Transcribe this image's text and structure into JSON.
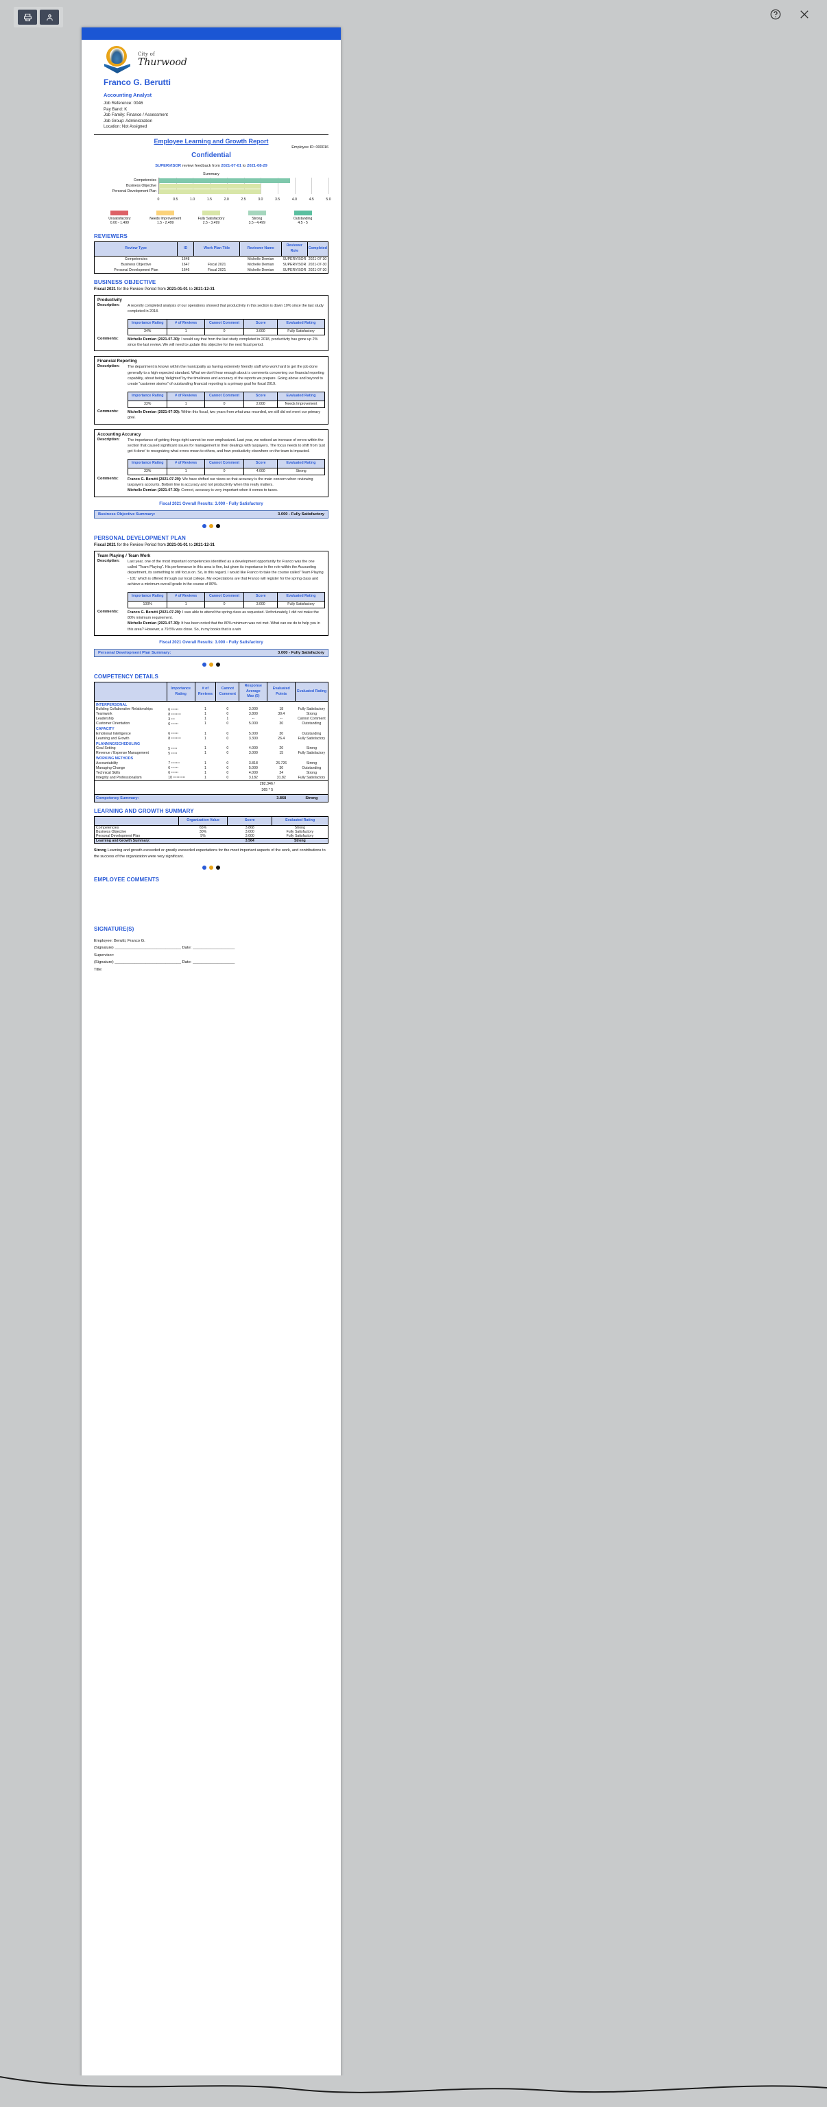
{
  "viewer": {
    "tools": [
      {
        "name": "print-tool",
        "icon": "printer-icon"
      },
      {
        "name": "person-tool",
        "icon": "person-icon"
      }
    ],
    "right_icons": [
      {
        "name": "help-button",
        "icon": "help-circle-icon"
      },
      {
        "name": "close-button",
        "icon": "close-icon"
      }
    ]
  },
  "logo": {
    "city_word": "City of",
    "name_word": "Thurwood"
  },
  "employee": {
    "name": "Franco G. Berutti",
    "title": "Accounting Analyst",
    "job_reference": "Job Reference: 0046",
    "pay_band": "Pay Band: K",
    "job_family": "Job Family: Finance / Assessment",
    "job_group": "Job Group: Administration",
    "location": "Location: Not Assigned",
    "employee_id": "Employee ID: 000016"
  },
  "report": {
    "title": "Employee Learning and Growth Report",
    "confidential": "Confidential",
    "feedback_role": "SUPERVISOR",
    "feedback_mid": " review feedback from ",
    "feedback_from": "2021-07-01",
    "feedback_to_sep": " to ",
    "feedback_to": "2021-08-29"
  },
  "chart_data": {
    "type": "bar",
    "title": "Summary",
    "orientation": "horizontal",
    "categories": [
      "Competencies",
      "Business Objective",
      "Personal Development Plan"
    ],
    "values": [
      3.868,
      3.0,
      3.0
    ],
    "colors": [
      "#7fc8ac",
      "#d8e6a8",
      "#d8e6a8"
    ],
    "xlabel": "",
    "ylabel": "",
    "xlim": [
      0,
      5
    ],
    "ticks": [
      "0",
      "0.5",
      "1.0",
      "1.5",
      "2.0",
      "2.5",
      "3.0",
      "3.5",
      "4.0",
      "4.5",
      "5.0"
    ],
    "grid": true,
    "legend_position": "below"
  },
  "legend": [
    {
      "label": "Unsatisfactory",
      "range": "0.00 - 1.499",
      "color": "#dd6166"
    },
    {
      "label": "Needs Improvement",
      "range": "1.5 - 2.499",
      "color": "#fbd27b"
    },
    {
      "label": "Fully Satisfactory",
      "range": "2.5 - 3.499",
      "color": "#d8e6a8"
    },
    {
      "label": "Strong",
      "range": "3.5 - 4.499",
      "color": "#a5d6bd"
    },
    {
      "label": "Outstanding",
      "range": "4.5 - 5",
      "color": "#5bbfa0"
    }
  ],
  "reviewers": {
    "heading": "REVIEWERS",
    "columns": [
      "Review Type",
      "ID",
      "Work Plan Title",
      "Reviewer Name",
      "Reviewer Role",
      "Completed"
    ],
    "rows": [
      [
        "Competencies",
        "1648",
        "",
        "Michelle Demian",
        "SUPERVISOR",
        "2021-07-30"
      ],
      [
        "Business Objective",
        "1647",
        "Fiscal 2021",
        "Michelle Demian",
        "SUPERVISOR",
        "2021-07-30"
      ],
      [
        "Personal Development Plan",
        "1646",
        "Fiscal 2021",
        "Michelle Demian",
        "SUPERVISOR",
        "2021-07-30"
      ]
    ]
  },
  "business_objective": {
    "heading": "BUSINESS OBJECTIVE",
    "fiscal_bold": "Fiscal 2021",
    "fiscal_mid": " for the Review Period from ",
    "period_from": "2021-01-01",
    "period_sep": " to ",
    "period_to": "2021-12-31",
    "score_columns": [
      "Importance Rating",
      "# of Reviews",
      "Cannot Comment",
      "Score",
      "Evaluated Rating"
    ],
    "label_description": "Description:",
    "label_comments": "Comments:",
    "items": [
      {
        "name": "Productivity",
        "description": "A recently completed analysis of our operations showed that productivity in this section is down 10% since the last study completed in 2018.",
        "scores": [
          "34%",
          "1",
          "0",
          "3.000",
          "Fully Satisfactory"
        ],
        "comments": [
          {
            "author": "Michelle Demian (2021-07-30):",
            "text": " I would say that from the last study completed in 2018, productivity has gone up 2% since the last review. We will need to update this objective for the next fiscal period."
          }
        ]
      },
      {
        "name": "Financial Reporting",
        "description": "The department is known within the municipality as having extremely friendly staff who work hard to get the job done generally to a high expected standard. What we don't hear enough about is comments concerning our financial reporting capability, about being 'delighted' by the timeliness and accuracy of the reports we prepare. Going above and beyond to create “customer stories” of outstanding financial reporting is a primary goal for fiscal 2019.",
        "scores": [
          "33%",
          "1",
          "0",
          "2.000",
          "Needs Improvement"
        ],
        "comments": [
          {
            "author": "Michelle Demian (2021-07-30):",
            "text": " Within this fiscal, two years from what was recorded, we still did not meet our primary goal."
          }
        ]
      },
      {
        "name": "Accounting Accuracy",
        "description": "The importance of getting things right cannot be over emphasized. Last year, we noticed an increase of errors within the section that caused significant issues for management in their dealings with taxpayers. The focus needs to shift from 'just get it done' to recognizing what errors mean to others, and how productivity elsewhere on the team is impacted.",
        "scores": [
          "33%",
          "1",
          "0",
          "4.000",
          "Strong"
        ],
        "comments": [
          {
            "author": "Franco G. Berutti (2021-07-29):",
            "text": " We have shifted our views so that accuracy is the main concern when reviewing taxpayers accounts. Bottom line is accuracy and not productivity when this really matters."
          },
          {
            "author": "Michelle Demian (2021-07-30):",
            "text": " Correct, accuracy is very important when it comes to taxes."
          }
        ]
      }
    ],
    "overall": "Fiscal 2021 Overall Results: 3.000 - Fully Satisfactory",
    "summary_label": "Business Objective Summary:",
    "summary_value": "3.000 - Fully Satisfactory"
  },
  "personal_development_plan": {
    "heading": "PERSONAL DEVELOPMENT PLAN",
    "fiscal_bold": "Fiscal 2021",
    "fiscal_mid": " for the Review Period from ",
    "period_from": "2021-01-01",
    "period_sep": " to ",
    "period_to": "2021-12-31",
    "items": [
      {
        "name": "Team Playing / Team Work",
        "description": "Last year, one of the most important competencies identified as a development opportunity for Franco was the one called \"Team Playing\". His performance in this area is fine, but given its importance in the role within the Accounting department, its something to still focus on. So, in this regard, I would like Franco to take the course called 'Team Playing - 101' which is offered through our local college. My expectations are that Franco will register for the spring class and achieve a minimum overall grade in the course of 80%.",
        "scores": [
          "100%",
          "1",
          "0",
          "3.000",
          "Fully Satisfactory"
        ],
        "comments": [
          {
            "author": "Franco G. Berutti (2021-07-29):",
            "text": " I was able to attend the spring class as requested. Unfortunately, I did not make the 80% minimum requirement."
          },
          {
            "author": "Michelle Demian (2021-07-30):",
            "text": " It has been noted that the 80% minimum was not met. What can we do to help you in this area? However, a 79.5% was close. So, in my books that is a win"
          }
        ]
      }
    ],
    "overall": "Fiscal 2021 Overall Results: 3.000 - Fully Satisfactory",
    "summary_label": "Personal Development Plan Summary:",
    "summary_value": "3.000 - Fully Satisfactory"
  },
  "competency_details": {
    "heading": "COMPETENCY DETAILS",
    "columns": [
      "",
      "Importance Rating",
      "# of Reviews",
      "Cannot Comment",
      "Response Average Max (5)",
      "Evaluated Points",
      "Evaluated Rating"
    ],
    "col_line1": [
      "",
      "Importance",
      "# of",
      "Cannot",
      "Response",
      "Evaluated",
      "Evaluated Rating"
    ],
    "col_line2": [
      "",
      "Rating",
      "Reviews",
      "Comment",
      "Average",
      "Points",
      ""
    ],
    "col_line3": [
      "",
      "",
      "",
      "",
      "Max (5)",
      "",
      ""
    ],
    "groups": [
      {
        "name": "INTERPERSONAL",
        "rows": [
          {
            "name": "Building Collaborative Relationships",
            "importance": "6",
            "stars": 6,
            "reviews": "1",
            "cannot": "0",
            "average": "3.000",
            "points": "18",
            "rating": "Fully Satisfactory"
          },
          {
            "name": "Teamwork",
            "importance": "8",
            "stars": 8,
            "reviews": "1",
            "cannot": "0",
            "average": "3.800",
            "points": "30.4",
            "rating": "Strong"
          },
          {
            "name": "Leadership",
            "importance": "3",
            "stars": 3,
            "reviews": "1",
            "cannot": "1",
            "average": "--",
            "points": "--",
            "rating": "Cannot Comment"
          },
          {
            "name": "Customer Orientation",
            "importance": "6",
            "stars": 6,
            "reviews": "1",
            "cannot": "0",
            "average": "5.000",
            "points": "30",
            "rating": "Outstanding"
          }
        ]
      },
      {
        "name": "CAPACITY",
        "rows": [
          {
            "name": "Emotional Intelligence",
            "importance": "6",
            "stars": 6,
            "reviews": "1",
            "cannot": "0",
            "average": "5.000",
            "points": "30",
            "rating": "Outstanding"
          },
          {
            "name": "Learning and Growth",
            "importance": "8",
            "stars": 8,
            "reviews": "1",
            "cannot": "0",
            "average": "3.300",
            "points": "26.4",
            "rating": "Fully Satisfactory"
          }
        ]
      },
      {
        "name": "PLANNING/SCHEDULING",
        "rows": [
          {
            "name": "Goal Setting",
            "importance": "5",
            "stars": 5,
            "reviews": "1",
            "cannot": "0",
            "average": "4.000",
            "points": "20",
            "rating": "Strong"
          },
          {
            "name": "Revenue / Expense Management",
            "importance": "5",
            "stars": 5,
            "reviews": "1",
            "cannot": "0",
            "average": "3.000",
            "points": "15",
            "rating": "Fully Satisfactory"
          }
        ]
      },
      {
        "name": "WORKING METHODS",
        "rows": [
          {
            "name": "Accountability",
            "importance": "7",
            "stars": 7,
            "reviews": "1",
            "cannot": "0",
            "average": "3.818",
            "points": "26.726",
            "rating": "Strong"
          },
          {
            "name": "Managing Change",
            "importance": "6",
            "stars": 6,
            "reviews": "1",
            "cannot": "0",
            "average": "5.000",
            "points": "30",
            "rating": "Outstanding"
          },
          {
            "name": "Technical Skills",
            "importance": "6",
            "stars": 6,
            "reviews": "1",
            "cannot": "0",
            "average": "4.000",
            "points": "24",
            "rating": "Strong"
          },
          {
            "name": "Integrity and Professionalism",
            "importance": "10",
            "stars": 10,
            "reviews": "1",
            "cannot": "0",
            "average": "3.182",
            "points": "31.82",
            "rating": "Fully Satisfactory"
          }
        ]
      }
    ],
    "total_numerator": "282.346 /",
    "total_denominator": "365 * 5",
    "summary_label": "Competency Summary:",
    "summary_score": "3.868",
    "summary_rating": "Strong"
  },
  "learning_growth_summary": {
    "heading": "LEARNING AND GROWTH SUMMARY",
    "columns": [
      "",
      "Organization Value",
      "Score",
      "Evaluated Rating"
    ],
    "rows": [
      [
        "Competencies",
        "65%",
        "3.868",
        "Strong"
      ],
      [
        "Business Objective",
        "30%",
        "3.000",
        "Fully Satisfactory"
      ],
      [
        "Personal Development Plan",
        "5%",
        "3.000",
        "Fully Satisfactory"
      ]
    ],
    "summary_label": "Learning and Growth Summary:",
    "summary_score": "3.564",
    "summary_rating": "Strong",
    "note_bold": "Strong",
    "note_text": "  Learning and growth exceeded or greatly exceeded expectations for the most important aspects of the work, and contributions to the success of the organization were very significant."
  },
  "employee_comments": {
    "heading": "EMPLOYEE COMMENTS"
  },
  "signatures": {
    "heading": "SIGNATURE(S)",
    "employee_line": "Employee: Berutti, Franco G.",
    "employee_sig": "(Signature) ______________________________          Date: ___________________",
    "supervisor_label": "Supervisor:",
    "supervisor_sig": "(Signature) ______________________________          Date: ___________________",
    "title_line": "Title:"
  },
  "dots": [
    "#2a5bd7",
    "#e8a317",
    "#111111"
  ]
}
